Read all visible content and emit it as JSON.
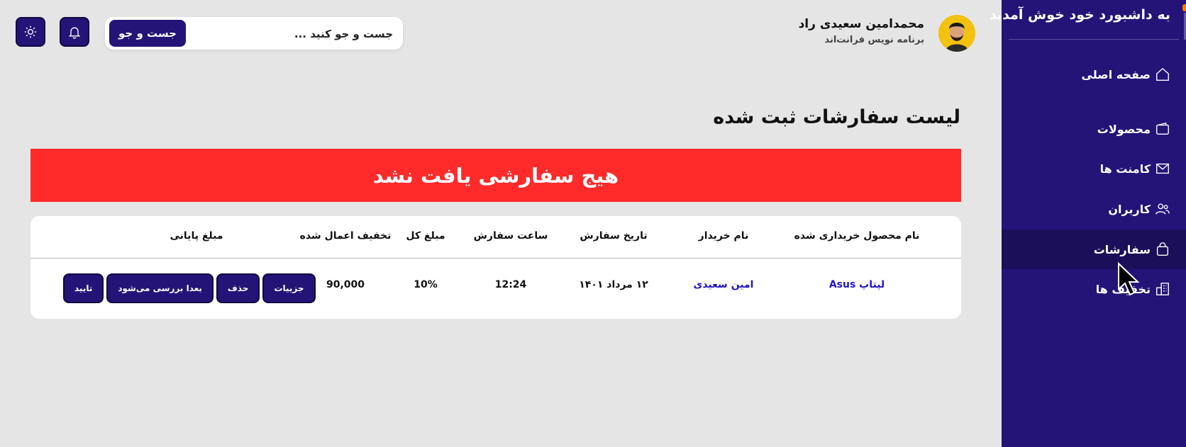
{
  "sidebar": {
    "title": "به داشبورد خود خوش آمدید",
    "items": [
      {
        "label": "صفحه اصلی",
        "icon": "home-icon"
      },
      {
        "label": "محصولات",
        "icon": "wallet-icon"
      },
      {
        "label": "کامنت ها",
        "icon": "mail-icon"
      },
      {
        "label": "کاربران",
        "icon": "users-icon"
      },
      {
        "label": "سفارشات",
        "icon": "shopping-bag-icon"
      },
      {
        "label": "تخفیف ها",
        "icon": "building-icon"
      }
    ],
    "active_item": "سفارشات"
  },
  "header": {
    "user_name": "محمدامین سعیدی راد",
    "user_role": "برنامه نویس فرانت‌اند",
    "search_placeholder": "جست و جو کنید ...",
    "search_button": "جست و جو",
    "notification_icon": "bell-icon",
    "theme_icon": "sun-icon"
  },
  "main": {
    "page_title": "لیست سفارشات ثبت شده",
    "empty_message": "هیج سفارشی یافت نشد",
    "table": {
      "headers": [
        "نام محصول خریداری شده",
        "نام خریدار",
        "تاریخ سفارش",
        "ساعت سفارش",
        "مبلغ کل",
        "تخفیف اعمال شده",
        "مبلغ پایانی"
      ],
      "rows": [
        {
          "product": "لپتاپ Asus",
          "buyer": "امین سعیدی",
          "date": "۱۲ مرداد ۱۴۰۱",
          "time": "12:24",
          "total": "10%",
          "discount": "90,000",
          "actions": [
            "جزییات",
            "حذف",
            "بعدا بررسی می‌شود",
            "تایید"
          ]
        }
      ]
    }
  },
  "colors": {
    "sidebar_bg": "#241478",
    "active_item_bg": "#1b0f5a",
    "banner_bg": "#ff2a2a",
    "link": "#1f14c8",
    "page_bg": "#e5e5e6"
  }
}
